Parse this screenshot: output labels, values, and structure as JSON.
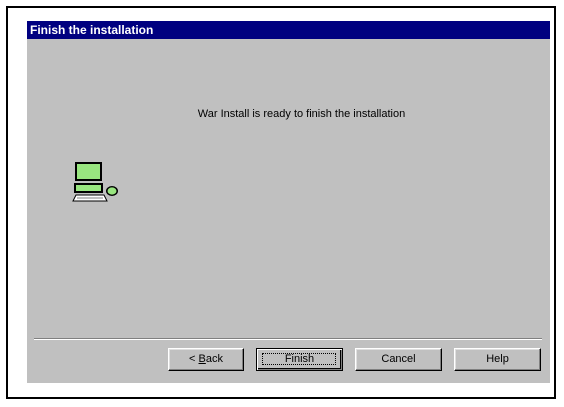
{
  "dialog": {
    "title": "Finish the installation",
    "message": "War Install is ready to finish the installation"
  },
  "buttons": {
    "back_prefix": "< ",
    "back_mnemonic": "B",
    "back_rest": "ack",
    "finish": "Finish",
    "cancel": "Cancel",
    "help": "Help"
  },
  "icons": {
    "computer": "computer-icon"
  },
  "colors": {
    "title_bar": "#000080",
    "dialog_face": "#c0c0c0",
    "monitor_screen": "#99e680"
  }
}
